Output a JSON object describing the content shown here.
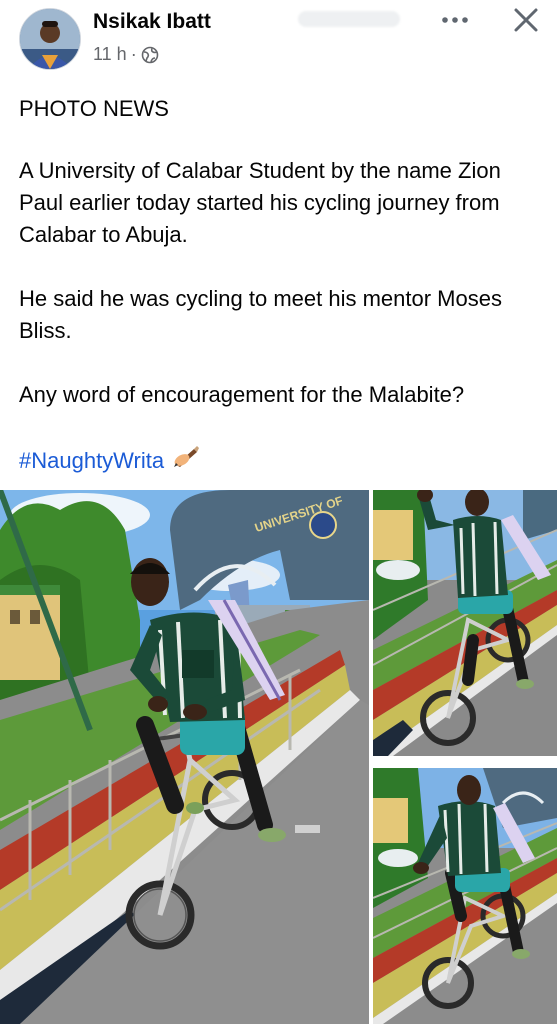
{
  "post": {
    "author": "Nsikak Ibatt",
    "time": "11 h",
    "separator": "·",
    "title": "PHOTO NEWS",
    "paragraph1": "A University of Calabar Student by the name Zion Paul earlier today started his cycling journey from Calabar to Abuja.",
    "paragraph2": "He said he was cycling to meet his mentor Moses Bliss.",
    "paragraph3": "Any word of encouragement for the Malabite?",
    "hashtag": "#NaughtyWrita"
  },
  "photos": {
    "main_sign": "UNIVERSITY OF"
  },
  "icons": {
    "more": "more-horizontal-icon",
    "close": "close-icon",
    "privacy": "globe-icon",
    "emoji": "writing-hand-icon"
  },
  "colors": {
    "link": "#1b5bd6",
    "meta": "#65676b",
    "text": "#050505"
  }
}
